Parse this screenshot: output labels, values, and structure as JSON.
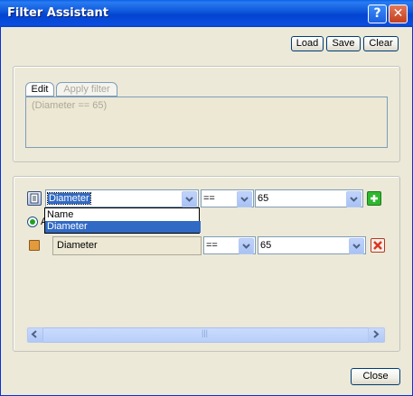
{
  "window": {
    "title": "Filter Assistant",
    "help_label": "?",
    "close_label": "✕"
  },
  "toolbar": {
    "load_label": "Load",
    "save_label": "Save",
    "clear_label": "Clear"
  },
  "filter_panel": {
    "tabs": [
      {
        "label": "Edit",
        "active": true
      },
      {
        "label": "Apply filter",
        "active": false
      }
    ],
    "expression": "(Diameter == 65)"
  },
  "rows": [
    {
      "field": "Diameter",
      "operator": "==",
      "value": "65",
      "action_icon": "add-icon"
    },
    {
      "field": "Diameter",
      "operator": "==",
      "value": "65",
      "action_icon": "delete-icon"
    }
  ],
  "dropdown": {
    "options": [
      "Name",
      "Diameter"
    ],
    "selected": "Diameter"
  },
  "radio_label": "A",
  "scrollbar": {
    "grip": "|||"
  },
  "footer": {
    "close_label": "Close"
  },
  "colors": {
    "title_blue": "#0b54d8",
    "add_green": "#2eb82e",
    "delete_red": "#d9381e",
    "selection": "#316ac5"
  }
}
